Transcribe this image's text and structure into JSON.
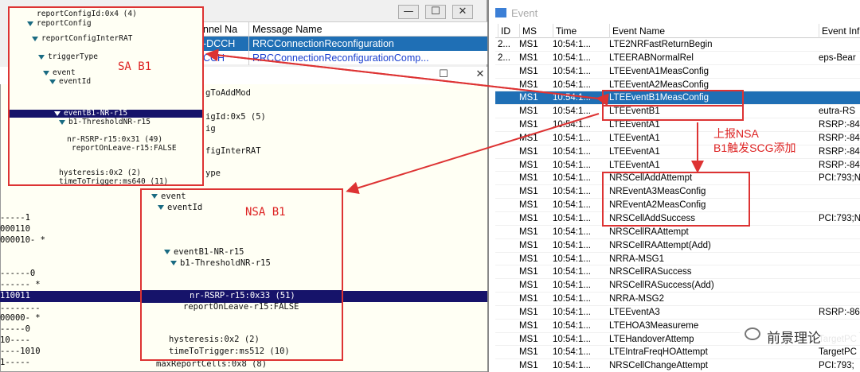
{
  "message_window": {
    "col_channel": "nnel Na",
    "col_message": "Message Name",
    "rows": [
      {
        "channel": "-DCCH",
        "message": "RRCConnectionReconfiguration",
        "selected": true
      },
      {
        "channel": "CCH",
        "message": "RRCConnectionReconfigurationComp...",
        "selected": false
      }
    ],
    "btn_min": "—",
    "btn_max": "☐",
    "btn_close": "✕"
  },
  "tree_window": {
    "btn_max": "☐",
    "btn_close": "✕",
    "partial_lines": [
      "gToAddMod",
      "igId:0x5 (5)",
      "ig",
      "figInterRAT",
      "ype"
    ],
    "hex_lines": [
      "-----1",
      "000110",
      "000010- *",
      "------0",
      "------ *",
      "110011",
      "--------",
      "00000- *",
      "-----0",
      "10----",
      "----1010",
      "1-----"
    ],
    "bottom_line": "maxReportCells:0x8 (8)"
  },
  "sa_box": {
    "label": "SA B1",
    "lines": [
      "reportConfigId:0x4 (4)",
      "reportConfig",
      "reportConfigInterRAT",
      "triggerType",
      "event",
      "eventId",
      "eventB1-NR-r15",
      "b1-ThresholdNR-r15",
      "nr-RSRP-r15:0x31 (49)",
      "reportOnLeave-r15:FALSE",
      "hysteresis:0x2 (2)",
      "timeToTrigger:ms640 (11)"
    ]
  },
  "nsa_box": {
    "label": "NSA B1",
    "lines": [
      "event",
      "eventId",
      "eventB1-NR-r15",
      "b1-ThresholdNR-r15",
      "nr-RSRP-r15:0x33 (51)",
      "reportOnLeave-r15:FALSE",
      "hysteresis:0x2 (2)",
      "timeToTrigger:ms512 (10)"
    ]
  },
  "event_window": {
    "title": "Event",
    "headers": {
      "id": "ID",
      "ms": "MS",
      "time": "Time",
      "name": "Event Name",
      "info": "Event Inf"
    },
    "rows": [
      {
        "id": "2...",
        "ms": "MS1",
        "time": "10:54:1...",
        "name": "LTE2NRFastReturnBegin",
        "info": ""
      },
      {
        "id": "2...",
        "ms": "MS1",
        "time": "10:54:1...",
        "name": "LTEERABNormalRel",
        "info": "eps-Bear"
      },
      {
        "id": "",
        "ms": "MS1",
        "time": "10:54:1...",
        "name": "LTEEventA1MeasConfig",
        "info": ""
      },
      {
        "id": "",
        "ms": "MS1",
        "time": "10:54:1...",
        "name": "LTEEventA2MeasConfig",
        "info": ""
      },
      {
        "id": "",
        "ms": "MS1",
        "time": "10:54:1...",
        "name": "LTEEventB1MeasConfig",
        "info": ""
      },
      {
        "id": "",
        "ms": "MS1",
        "time": "10:54:1...",
        "name": "LTEEventB1",
        "info": "eutra-RS"
      },
      {
        "id": "",
        "ms": "MS1",
        "time": "10:54:1...",
        "name": "LTEEventA1",
        "info": "RSRP:-84"
      },
      {
        "id": "",
        "ms": "MS1",
        "time": "10:54:1...",
        "name": "LTEEventA1",
        "info": "RSRP:-84"
      },
      {
        "id": "",
        "ms": "MS1",
        "time": "10:54:1...",
        "name": "LTEEventA1",
        "info": "RSRP:-84"
      },
      {
        "id": "",
        "ms": "MS1",
        "time": "10:54:1...",
        "name": "LTEEventA1",
        "info": "RSRP:-84"
      },
      {
        "id": "",
        "ms": "MS1",
        "time": "10:54:1...",
        "name": "NRSCellAddAttempt",
        "info": "PCI:793;N"
      },
      {
        "id": "",
        "ms": "MS1",
        "time": "10:54:1...",
        "name": "NREventA3MeasConfig",
        "info": ""
      },
      {
        "id": "",
        "ms": "MS1",
        "time": "10:54:1...",
        "name": "NREventA2MeasConfig",
        "info": ""
      },
      {
        "id": "",
        "ms": "MS1",
        "time": "10:54:1...",
        "name": "NRSCellAddSuccess",
        "info": "PCI:793;N"
      },
      {
        "id": "",
        "ms": "MS1",
        "time": "10:54:1...",
        "name": "NRSCellRAAttempt",
        "info": ""
      },
      {
        "id": "",
        "ms": "MS1",
        "time": "10:54:1...",
        "name": "NRSCellRAAttempt(Add)",
        "info": ""
      },
      {
        "id": "",
        "ms": "MS1",
        "time": "10:54:1...",
        "name": "NRRA-MSG1",
        "info": ""
      },
      {
        "id": "",
        "ms": "MS1",
        "time": "10:54:1...",
        "name": "NRSCellRASuccess",
        "info": ""
      },
      {
        "id": "",
        "ms": "MS1",
        "time": "10:54:1...",
        "name": "NRSCellRASuccess(Add)",
        "info": ""
      },
      {
        "id": "",
        "ms": "MS1",
        "time": "10:54:1...",
        "name": "NRRA-MSG2",
        "info": ""
      },
      {
        "id": "",
        "ms": "MS1",
        "time": "10:54:1...",
        "name": "LTEEventA3",
        "info": "RSRP:-86"
      },
      {
        "id": "",
        "ms": "MS1",
        "time": "10:54:1...",
        "name": "LTEHOA3Measureme",
        "info": ""
      },
      {
        "id": "",
        "ms": "MS1",
        "time": "10:54:1...",
        "name": "LTEHandoverAttemp",
        "info": "TargetPC"
      },
      {
        "id": "",
        "ms": "MS1",
        "time": "10:54:1...",
        "name": "LTEIntraFreqHOAttempt",
        "info": "TargetPC"
      },
      {
        "id": "",
        "ms": "MS1",
        "time": "10:54:1...",
        "name": "NRSCellChangeAttempt",
        "info": "PCI:793;"
      }
    ],
    "selected_index": 4
  },
  "annotation": {
    "line1": "上报NSA",
    "line2": "B1触发SCG添加"
  },
  "watermark": "前景理论",
  "colors": {
    "highlight": "#16136a",
    "selection": "#1f6fb5",
    "annotation": "#dd2222",
    "tree_bg": "#fffff4"
  }
}
